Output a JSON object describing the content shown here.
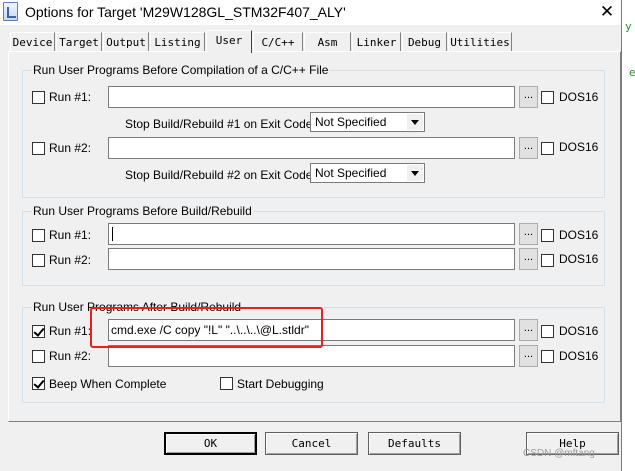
{
  "window": {
    "title": "Options for Target 'M29W128GL_STM32F407_ALY'",
    "close_glyph": "✕"
  },
  "tabs": [
    {
      "label": "Device",
      "active": false
    },
    {
      "label": "Target",
      "active": false
    },
    {
      "label": "Output",
      "active": false
    },
    {
      "label": "Listing",
      "active": false
    },
    {
      "label": "User",
      "active": true
    },
    {
      "label": "C/C++",
      "active": false
    },
    {
      "label": "Asm",
      "active": false
    },
    {
      "label": "Linker",
      "active": false
    },
    {
      "label": "Debug",
      "active": false
    },
    {
      "label": "Utilities",
      "active": false
    }
  ],
  "before_compile": {
    "title": "Run User Programs Before Compilation of a C/C++ File",
    "run1": {
      "label": "Run #1:",
      "checked": false,
      "value": "",
      "dos16": "DOS16"
    },
    "run2": {
      "label": "Run #2:",
      "checked": false,
      "value": "",
      "dos16": "DOS16"
    },
    "stop1_label": "Stop Build/Rebuild #1 on Exit Code:",
    "stop1_value": "Not Specified",
    "stop2_label": "Stop Build/Rebuild #2 on Exit Code:",
    "stop2_value": "Not Specified"
  },
  "before_build": {
    "title": "Run User Programs Before Build/Rebuild",
    "run1": {
      "label": "Run #1:",
      "checked": false,
      "value": "",
      "dos16": "DOS16"
    },
    "run2": {
      "label": "Run #2:",
      "checked": false,
      "value": "",
      "dos16": "DOS16"
    }
  },
  "after_build": {
    "title": "Run User Programs After Build/Rebuild",
    "run1": {
      "label": "Run #1:",
      "checked": true,
      "value": "cmd.exe /C copy \"!L\" \"..\\..\\..\\@L.stldr\"",
      "dos16": "DOS16"
    },
    "run2": {
      "label": "Run #2:",
      "checked": false,
      "value": "",
      "dos16": "DOS16"
    },
    "beep": {
      "label": "Beep When Complete",
      "checked": true
    },
    "start_debug": {
      "label": "Start Debugging",
      "checked": false
    }
  },
  "browse_glyph": "...",
  "buttons": {
    "ok": "OK",
    "cancel": "Cancel",
    "defaults": "Defaults",
    "help": "Help"
  },
  "watermark": "CSDN @mftang",
  "annotation_color": "#e8201e"
}
